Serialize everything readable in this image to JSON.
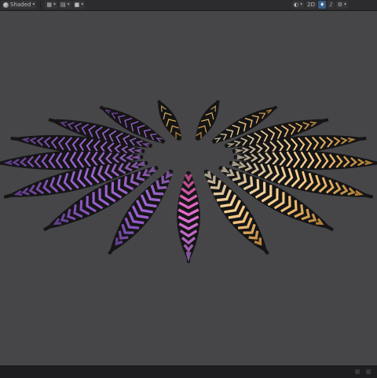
{
  "toolbar": {
    "shading_mode": "Shaded",
    "view_2d_label": "2D",
    "tools_left": [
      {
        "name": "draw-mode-icon"
      },
      {
        "name": "gizmo-icon"
      },
      {
        "name": "camera-icon"
      }
    ],
    "tools_right": [
      {
        "name": "effects-icon"
      },
      {
        "name": "lighting-icon"
      },
      {
        "name": "audio-icon"
      },
      {
        "name": "gizmos-icon"
      }
    ]
  },
  "scene": {
    "object": "radial-feather-array",
    "feather_count": 17,
    "gradient_colors": {
      "pink": "#ff5fb2",
      "violet": "#b978e6",
      "gold": "#f2a63a",
      "white": "#fff2d8"
    },
    "background": "#464649"
  }
}
